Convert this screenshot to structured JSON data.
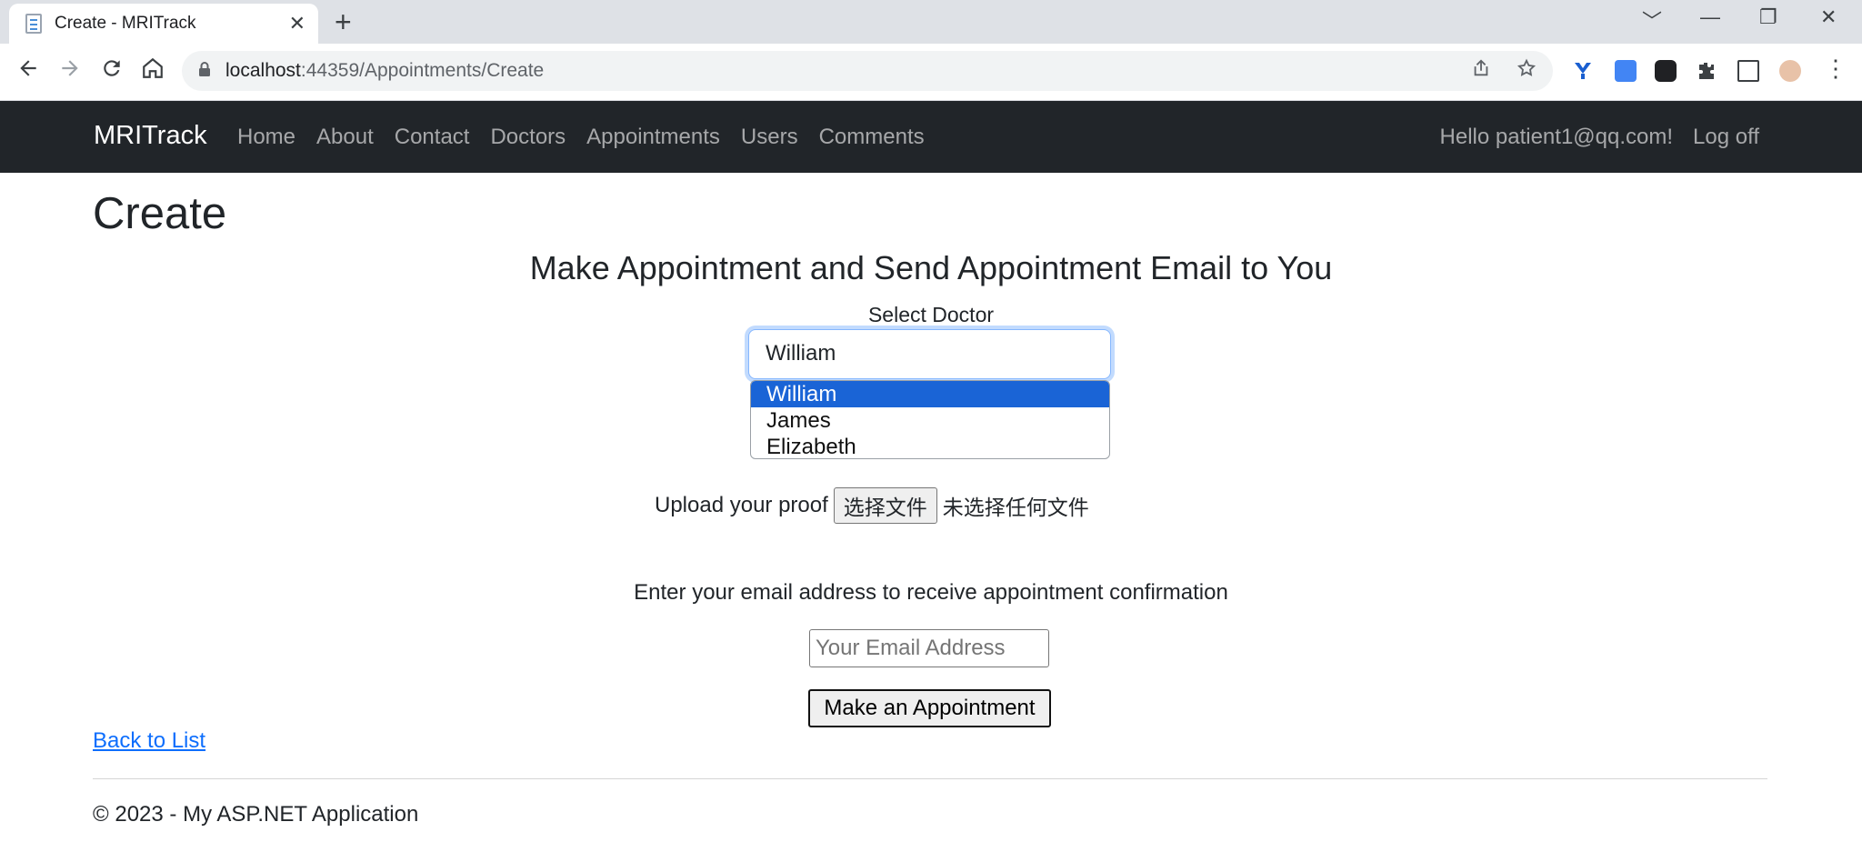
{
  "browser": {
    "tab_title": "Create - MRITrack",
    "tab_close": "✕",
    "new_tab": "+",
    "url_host": "localhost",
    "url_path": ":44359/Appointments/Create",
    "window_controls": [
      "﹀",
      "—",
      "❐",
      "✕"
    ]
  },
  "navbar": {
    "brand": "MRITrack",
    "links": [
      "Home",
      "About",
      "Contact",
      "Doctors",
      "Appointments",
      "Users",
      "Comments"
    ],
    "greeting": "Hello patient1@qq.com!",
    "logoff": "Log off"
  },
  "page": {
    "title": "Create",
    "subtitle": "Make Appointment and Send Appointment Email to You",
    "select_label": "Select Doctor",
    "selected_doctor": "William",
    "doctor_options": [
      "William",
      "James",
      "Elizabeth"
    ],
    "upload_label": "Upload your proof",
    "file_button": "选择文件",
    "file_status": "未选择任何文件",
    "email_label": "Enter your email address to receive appointment confirmation",
    "email_placeholder": "Your Email Address",
    "email_value": "",
    "submit_label": "Make an Appointment",
    "back_link": "Back to List"
  },
  "footer": {
    "text": "© 2023 - My ASP.NET Application"
  },
  "colors": {
    "navbar_bg": "#212529",
    "link": "#0d6efd",
    "option_selected": "#1a64d6"
  },
  "icons": [
    "back-arrow-icon",
    "forward-arrow-icon",
    "reload-icon",
    "home-icon",
    "lock-icon",
    "share-icon",
    "star-icon",
    "extension-icon",
    "sidebar-icon",
    "profile-avatar"
  ]
}
